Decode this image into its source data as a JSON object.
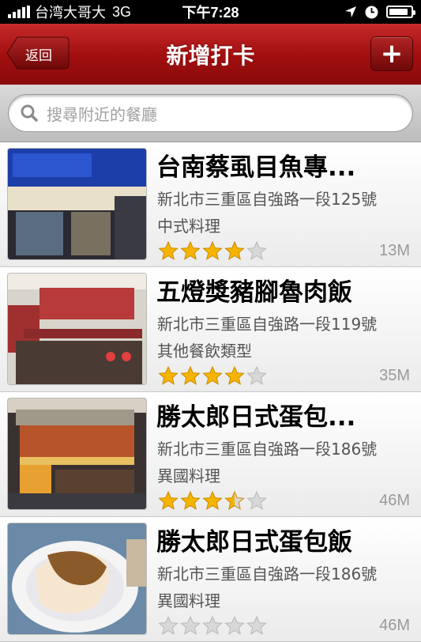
{
  "status_bar": {
    "carrier": "台湾大哥大",
    "network": "3G",
    "time": "下午7:28",
    "battery_level": 0.9
  },
  "nav": {
    "back_label": "返回",
    "title": "新增打卡",
    "add_label": "+"
  },
  "search": {
    "placeholder": "搜尋附近的餐廳"
  },
  "colors": {
    "nav_red": "#a30f10",
    "star_gold": "#f5b400",
    "star_empty": "#d8d8d8"
  },
  "restaurants": [
    {
      "name": "台南蔡虱目魚專...",
      "address": "新北市三重區自強路一段125號",
      "category": "中式料理",
      "rating": 4,
      "distance": "13M",
      "photo_icon": "storefront-photo"
    },
    {
      "name": "五燈獎豬腳魯肉飯",
      "address": "新北市三重區自強路一段119號",
      "category": "其他餐飲類型",
      "rating": 4,
      "distance": "35M",
      "photo_icon": "storefront-photo"
    },
    {
      "name": "勝太郎日式蛋包...",
      "address": "新北市三重區自強路一段186號",
      "category": "異國料理",
      "rating": 3.5,
      "distance": "46M",
      "photo_icon": "storefront-photo"
    },
    {
      "name": "勝太郎日式蛋包飯",
      "address": "新北市三重區自強路一段186號",
      "category": "異國料理",
      "rating": 0,
      "distance": "46M",
      "photo_icon": "food-photo"
    }
  ]
}
